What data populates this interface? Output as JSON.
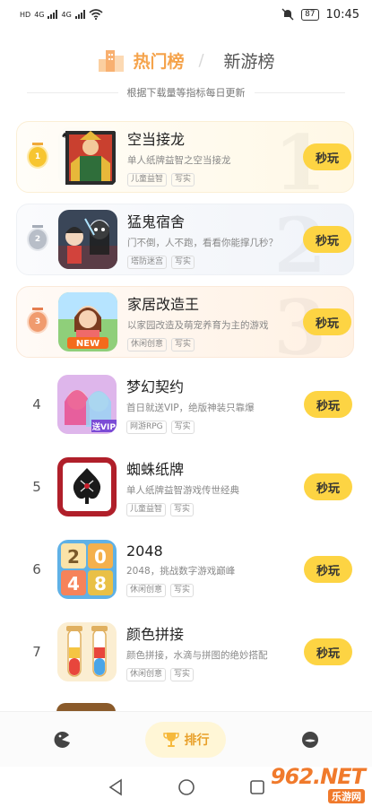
{
  "status": {
    "left_labels": [
      "HD",
      "4G",
      "4G"
    ],
    "battery": "87",
    "time": "10:45",
    "icons": [
      "wifi-icon",
      "mute-bell-icon",
      "battery-icon"
    ]
  },
  "tabs": {
    "hot": "热门榜",
    "separator": "/",
    "new": "新游榜",
    "active": "hot"
  },
  "subtitle": "根据下载量等指标每日更新",
  "play_label": "秒玩",
  "games": [
    {
      "rank": "1",
      "name": "空当接龙",
      "desc": "单人纸牌益智之空当接龙",
      "tags": [
        "儿童益智",
        "写实"
      ]
    },
    {
      "rank": "2",
      "name": "猛鬼宿舍",
      "desc": "门不倒，人不跑，看看你能撑几秒？",
      "tags": [
        "塔防迷宫",
        "写实"
      ]
    },
    {
      "rank": "3",
      "name": "家居改造王",
      "desc": "以家园改造及萌宠养育为主的游戏",
      "tags": [
        "休闲创意",
        "写实"
      ]
    },
    {
      "rank": "4",
      "name": "梦幻契约",
      "desc": "首日就送VIP，绝版神装只靠爆",
      "tags": [
        "网游RPG",
        "写实"
      ]
    },
    {
      "rank": "5",
      "name": "蜘蛛纸牌",
      "desc": "单人纸牌益智游戏传世经典",
      "tags": [
        "儿童益智",
        "写实"
      ]
    },
    {
      "rank": "6",
      "name": "2048",
      "desc": "2048，挑战数字游戏巅峰",
      "tags": [
        "休闲创意",
        "写实"
      ]
    },
    {
      "rank": "7",
      "name": "颜色拼接",
      "desc": "颜色拼接，水滴与拼图的绝妙搭配",
      "tags": [
        "休闲创意",
        "写实"
      ]
    }
  ],
  "icon_text": {
    "new_badge": "NEW",
    "vip_badge": "送VIP",
    "num_2048": [
      "2",
      "0",
      "4",
      "8"
    ]
  },
  "bottom_nav": {
    "rank_label": "排行",
    "active": "rank"
  },
  "watermark": {
    "top": "962.NET",
    "bottom": "乐游网"
  },
  "colors": {
    "accent": "#f5a34b",
    "button": "#fdd443",
    "gold": "#f7c531",
    "silver": "#b8bec8",
    "bronze": "#f09b6e"
  }
}
